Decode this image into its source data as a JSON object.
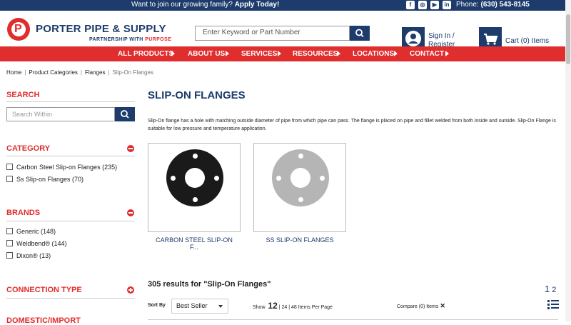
{
  "topbar": {
    "promo_text": "Want to join our growing family?",
    "promo_link": "Apply Today!",
    "social": [
      {
        "icon": "facebook-icon",
        "glyph": "f"
      },
      {
        "icon": "instagram-icon",
        "glyph": "◎"
      },
      {
        "icon": "youtube-icon",
        "glyph": "▶"
      },
      {
        "icon": "linkedin-icon",
        "glyph": "in"
      }
    ],
    "phone_label": "Phone:",
    "phone_number": "(630) 543-8145"
  },
  "brand": {
    "name": "PORTER PIPE & SUPPLY",
    "tagline_prefix": "PARTNERSHIP WITH",
    "tagline_accent": "PURPOSE",
    "primary_color": "#1d3c6b",
    "accent_color": "#e02d2d"
  },
  "header": {
    "search_placeholder": "Enter Keyword or Part Number",
    "signin_line1": "Sign In /",
    "signin_line2": "Register",
    "cart_label": "Cart (0) Items"
  },
  "nav": {
    "items": [
      {
        "label": "ALL PRODUCTS"
      },
      {
        "label": "ABOUT US"
      },
      {
        "label": "SERVICES"
      },
      {
        "label": "RESOURCES"
      },
      {
        "label": "LOCATIONS"
      },
      {
        "label": "CONTACT"
      }
    ]
  },
  "breadcrumb": [
    "Home",
    "Product Categories",
    "Flanges",
    "Slip-On Flanges"
  ],
  "sidebar": {
    "search_title": "SEARCH",
    "search_placeholder": "Search Within",
    "category_title": "CATEGORY",
    "categories": [
      {
        "label": "Carbon Steel Slip-on Flanges (235)"
      },
      {
        "label": "Ss Slip-on Flanges (70)"
      }
    ],
    "brands_title": "BRANDS",
    "brands": [
      {
        "label": "Generic (148)"
      },
      {
        "label": "Weldbend® (144)"
      },
      {
        "label": "Dixon® (13)"
      }
    ],
    "connection_title": "CONNECTION TYPE",
    "domestic_title": "DOMESTIC/IMPORT"
  },
  "main": {
    "title": "SLIP-ON FLANGES",
    "description": "Slip-On flange has a hole with matching outside diameter of pipe from which pipe can pass. The flange is placed on pipe and fillet welded from both inside and outside. Slip-On Flange is suitable for low pressure and temperature application.",
    "subcategories": [
      {
        "label_line1": "CARBON STEEL SLIP-ON",
        "label_line2": "F...",
        "color": "#1a1a1a"
      },
      {
        "label_line1": "SS SLIP-ON FLANGES",
        "label_line2": "",
        "color": "#b5b5b5"
      }
    ],
    "results_text": "305 results for \"Slip-On Flanges\"",
    "pages": [
      "1",
      "2"
    ],
    "sort_label": "Sort By",
    "sort_value": "Best Seller",
    "show_label": "Show",
    "show_current": "12",
    "show_other": "| 24 | 48 Items Per Page",
    "compare_label": "Compare (0) Items"
  }
}
